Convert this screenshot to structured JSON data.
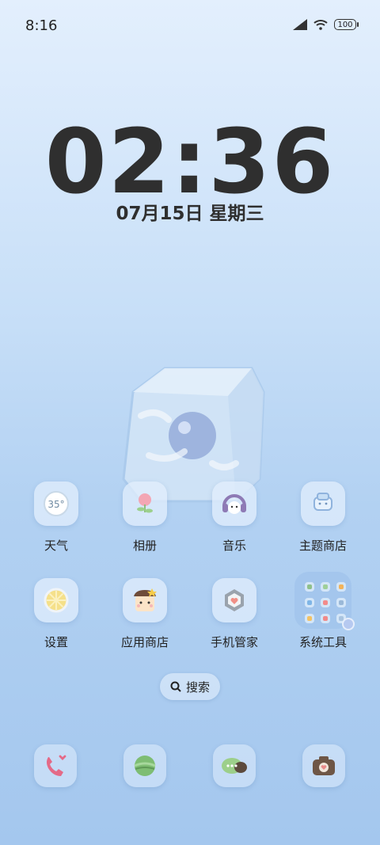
{
  "status_bar": {
    "time": "8:16",
    "battery": "100"
  },
  "lock": {
    "clock": "02:36",
    "date": "07月15日 星期三"
  },
  "apps_row1": [
    {
      "label": "天气",
      "icon": "weather-icon",
      "temp": "35°"
    },
    {
      "label": "相册",
      "icon": "gallery-icon"
    },
    {
      "label": "音乐",
      "icon": "music-icon"
    },
    {
      "label": "主题商店",
      "icon": "theme-store-icon"
    }
  ],
  "apps_row2": [
    {
      "label": "设置",
      "icon": "settings-icon"
    },
    {
      "label": "应用商店",
      "icon": "app-store-icon"
    },
    {
      "label": "手机管家",
      "icon": "phone-manager-icon"
    },
    {
      "label": "系统工具",
      "icon": "folder-icon"
    }
  ],
  "search": {
    "label": "搜索"
  },
  "dock": [
    {
      "icon": "phone-icon"
    },
    {
      "icon": "browser-icon"
    },
    {
      "icon": "messages-icon"
    },
    {
      "icon": "camera-icon"
    }
  ],
  "colors": {
    "accent": "#a4c7ee",
    "text": "#2f2f2f"
  }
}
